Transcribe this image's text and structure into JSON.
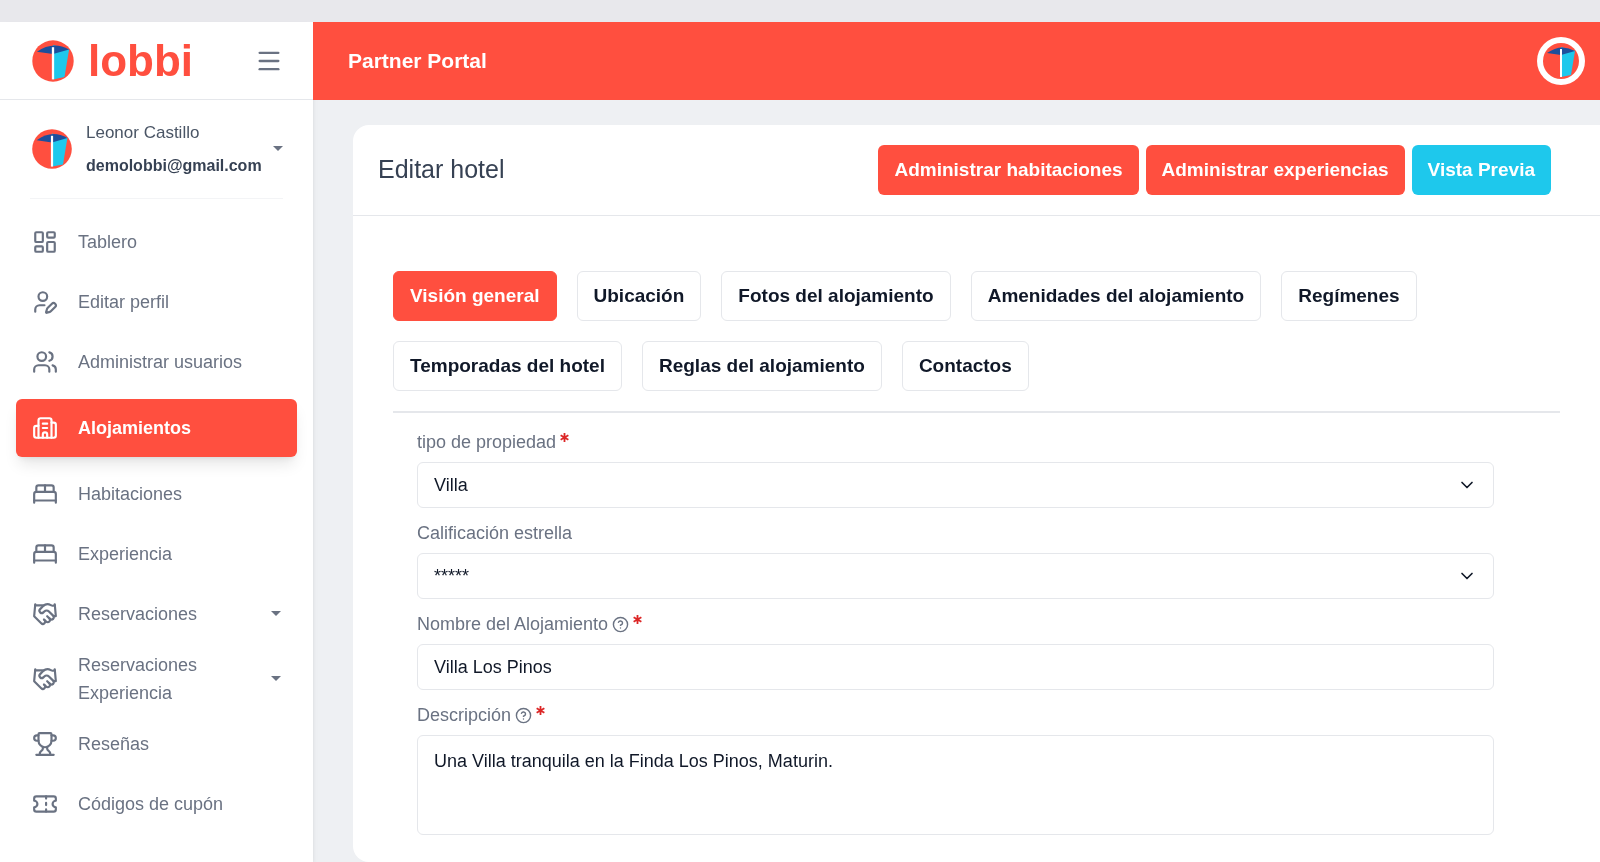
{
  "logo": {
    "text": "lobbi"
  },
  "header": {
    "title": "Partner Portal"
  },
  "user": {
    "name": "Leonor Castillo",
    "email": "demolobbi@gmail.com"
  },
  "sidebar": {
    "items": [
      {
        "label": "Tablero",
        "selected": false,
        "expandable": false
      },
      {
        "label": "Editar perfil",
        "selected": false,
        "expandable": false
      },
      {
        "label": "Administrar usuarios",
        "selected": false,
        "expandable": false
      },
      {
        "label": "Alojamientos",
        "selected": true,
        "expandable": false
      },
      {
        "label": "Habitaciones",
        "selected": false,
        "expandable": false
      },
      {
        "label": "Experiencia",
        "selected": false,
        "expandable": false
      },
      {
        "label": "Reservaciones",
        "selected": false,
        "expandable": true
      },
      {
        "label": "Reservaciones Experiencia",
        "selected": false,
        "expandable": true
      },
      {
        "label": "Reseñas",
        "selected": false,
        "expandable": false
      },
      {
        "label": "Códigos de cupón",
        "selected": false,
        "expandable": false
      }
    ]
  },
  "page": {
    "title": "Editar hotel",
    "buttons": [
      {
        "label": "Administrar habitaciones",
        "color": "#ff4f3f"
      },
      {
        "label": "Administrar experiencias",
        "color": "#ff4f3f"
      },
      {
        "label": "Vista Previa",
        "color": "#1ec8ec"
      }
    ]
  },
  "tabs": [
    {
      "label": "Visión general",
      "selected": true
    },
    {
      "label": "Ubicación",
      "selected": false
    },
    {
      "label": "Fotos del alojamiento",
      "selected": false
    },
    {
      "label": "Amenidades del alojamiento",
      "selected": false
    },
    {
      "label": "Regímenes",
      "selected": false
    },
    {
      "label": "Temporadas del hotel",
      "selected": false
    },
    {
      "label": "Reglas del alojamiento",
      "selected": false
    },
    {
      "label": "Contactos",
      "selected": false
    }
  ],
  "fields": [
    {
      "kind": "select",
      "label": "tipo de propiedad",
      "required": true,
      "help": false,
      "value": "Villa"
    },
    {
      "kind": "select",
      "label": "Calificación estrella",
      "required": false,
      "help": false,
      "value": "*****"
    },
    {
      "kind": "text",
      "label": "Nombre del Alojamiento",
      "required": true,
      "help": true,
      "value": "Villa Los Pinos"
    },
    {
      "kind": "textarea",
      "label": "Descripción",
      "required": true,
      "help": true,
      "value": "Una Villa tranquila en la Finda Los Pinos, Maturin."
    }
  ]
}
